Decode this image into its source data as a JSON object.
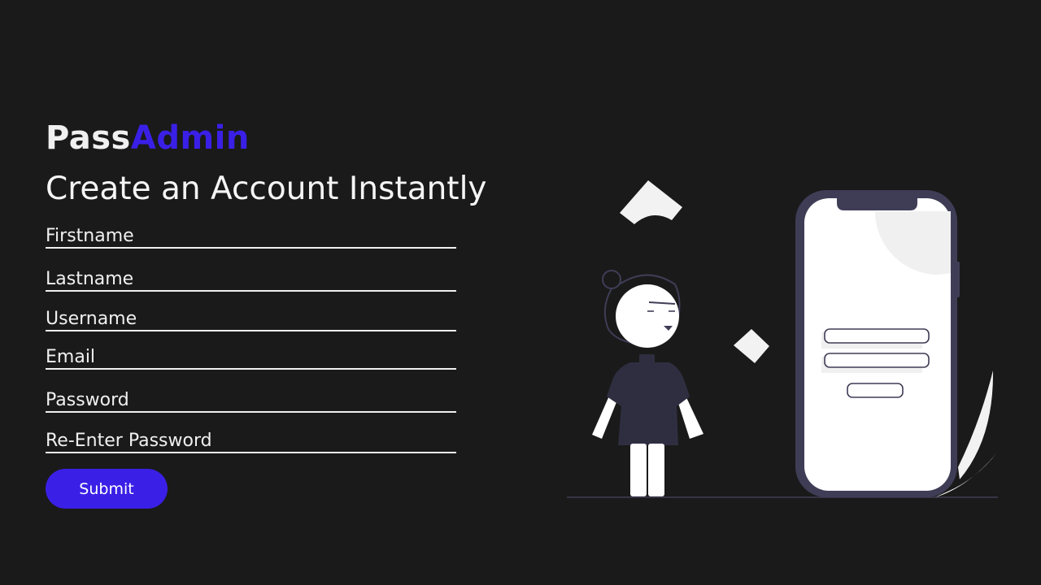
{
  "brand": {
    "part1": "Pass",
    "part2": "Admin"
  },
  "heading": "Create an Account Instantly",
  "form": {
    "fields": [
      {
        "placeholder": "Firstname",
        "value": ""
      },
      {
        "placeholder": "Lastname",
        "value": ""
      },
      {
        "placeholder": "Username",
        "value": ""
      },
      {
        "placeholder": "Email",
        "value": ""
      },
      {
        "placeholder": "Password",
        "value": ""
      },
      {
        "placeholder": "Re-Enter Password",
        "value": ""
      }
    ],
    "submit_label": "Submit"
  },
  "colors": {
    "background": "#1a1a1a",
    "accent": "#3a20e6",
    "text": "#f5f5f5",
    "illustration_dark": "#3f3d56",
    "illustration_light": "#f2f2f2"
  },
  "illustration": {
    "name": "person-with-phone-login-illustration"
  }
}
